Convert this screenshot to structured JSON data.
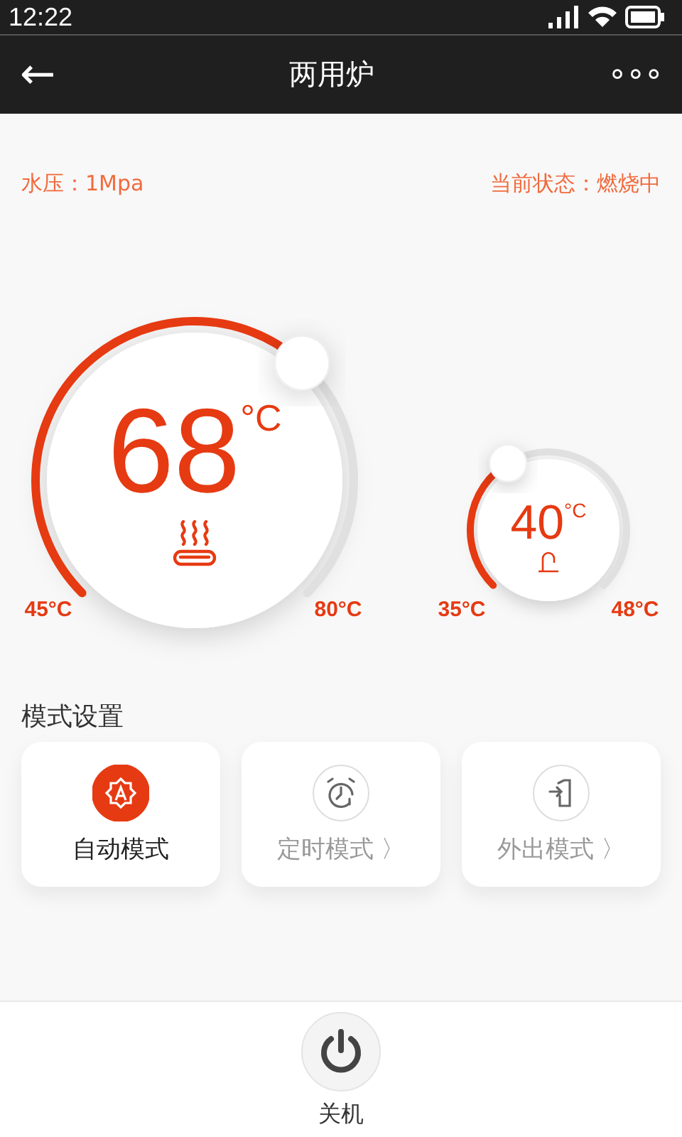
{
  "status_bar": {
    "time": "12:22"
  },
  "nav": {
    "back": "←",
    "title": "两用炉",
    "more": "∘∘∘"
  },
  "info": {
    "pressure": "水压：1Mpa",
    "state": "当前状态：燃烧中"
  },
  "dials": [
    {
      "kind": "heating",
      "value": "68",
      "unit": "°C",
      "min_label": "45°C",
      "max_label": "80°C"
    },
    {
      "kind": "water",
      "value": "40",
      "unit": "°C",
      "min_label": "35°C",
      "max_label": "48°C"
    }
  ],
  "modes_title": "模式设置",
  "modes": [
    {
      "kind": "auto",
      "label": "自动模式",
      "selected": true
    },
    {
      "kind": "timer",
      "label": "定时模式",
      "arrow": "〉",
      "selected": false
    },
    {
      "kind": "away",
      "label": "外出模式",
      "arrow": "〉",
      "selected": false
    }
  ],
  "power": {
    "label": "关机"
  }
}
